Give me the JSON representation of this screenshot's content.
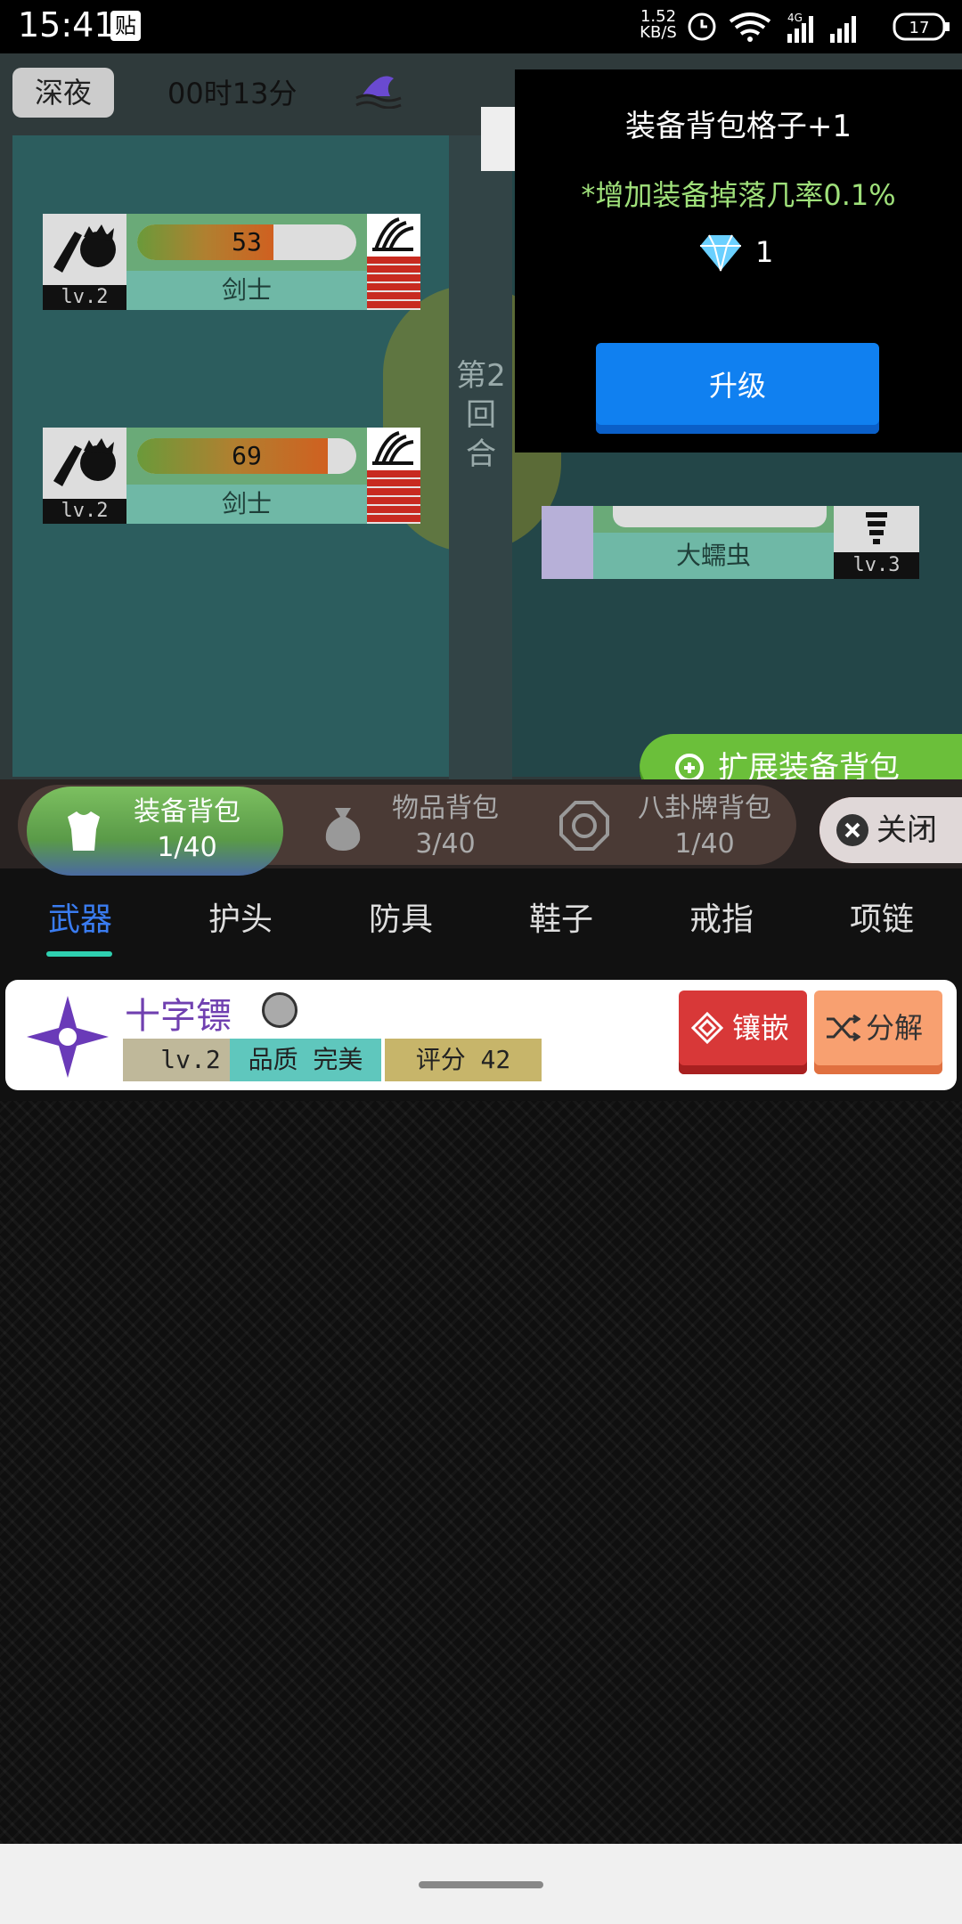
{
  "status_bar": {
    "time": "15:41",
    "tie_icon_label": "贴",
    "speed_value": "1.52",
    "speed_unit": "KB/S",
    "battery": "17",
    "network": "4G"
  },
  "game": {
    "night_label": "深夜",
    "timer": "00时13分",
    "round_text": "第2回合",
    "allies": [
      {
        "hp": "53",
        "hp_percent": 62,
        "name": "剑士",
        "level": "lv.2"
      },
      {
        "hp": "69",
        "hp_percent": 87,
        "name": "剑士",
        "level": "lv.2"
      }
    ],
    "enemy": {
      "name": "大蠕虫",
      "level": "lv.3"
    },
    "expand_button_label": "扩展装备背包"
  },
  "popup": {
    "title": "装备背包格子+1",
    "description": "*增加装备掉落几率0.1%",
    "gem_count": "1",
    "upgrade_label": "升级"
  },
  "bag_tabs": [
    {
      "label": "装备背包",
      "count": "1/40",
      "icon": "armor-icon"
    },
    {
      "label": "物品背包",
      "count": "3/40",
      "icon": "bag-icon"
    },
    {
      "label": "八卦牌背包",
      "count": "1/40",
      "icon": "bagua-icon"
    }
  ],
  "close_label": "关闭",
  "categories": [
    "武器",
    "护头",
    "防具",
    "鞋子",
    "戒指",
    "项链"
  ],
  "active_category": "武器",
  "items": [
    {
      "name": "十字镖",
      "level": "lv.2",
      "quality": "品质 完美",
      "score": "评分 42",
      "inlay_label": "镶嵌",
      "decompose_label": "分解"
    }
  ],
  "colors": {
    "accent_blue": "#1080f0",
    "active_tab_text": "#3a7cf0",
    "underline": "#2fd0b0",
    "item_name": "#7040b0"
  }
}
